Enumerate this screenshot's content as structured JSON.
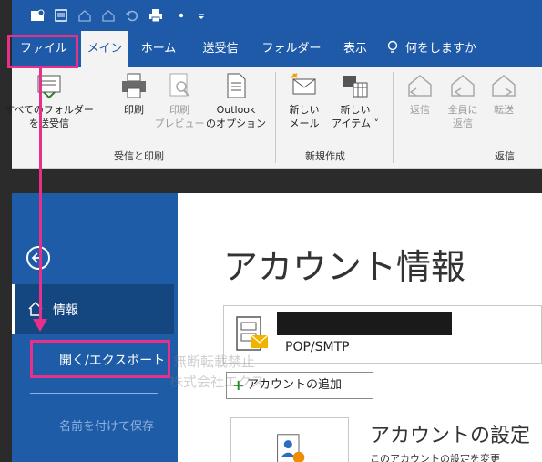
{
  "tabs": [
    "ファイル",
    "メイン",
    "ホーム",
    "送受信",
    "フォルダー",
    "表示"
  ],
  "tell_me": "何をしますか",
  "ribbon_buttons": {
    "send_receive_all": [
      "すべてのフォルダー",
      "を送受信"
    ],
    "print": "印刷",
    "print_preview": [
      "印刷",
      "プレビュー"
    ],
    "outlook_options": [
      "Outlook",
      "のオプション"
    ],
    "new_mail": [
      "新しい",
      "メール"
    ],
    "new_item": [
      "新しい",
      "アイテム ˅"
    ],
    "reply": "返信",
    "reply_all": [
      "全員に",
      "返信"
    ],
    "forward": "転送"
  },
  "groups": {
    "send_print": "受信と印刷",
    "new": "新規作成",
    "respond": "返信"
  },
  "backstage": {
    "nav_info": "情報",
    "nav_open_export": "開く/エクスポート",
    "nav_save_as": "名前を付けて保存",
    "title": "アカウント情報",
    "account_type": "POP/SMTP",
    "add_account": "アカウントの追加",
    "account_settings_title": "アカウントの設定",
    "account_settings_desc": "このアカウントの設定を変更"
  },
  "watermark": [
    "無断転載禁止",
    "株式会社エクス"
  ],
  "colors": {
    "office_blue": "#1f5aa8",
    "backstage_selected": "#14467f",
    "highlight": "#e8308a"
  }
}
